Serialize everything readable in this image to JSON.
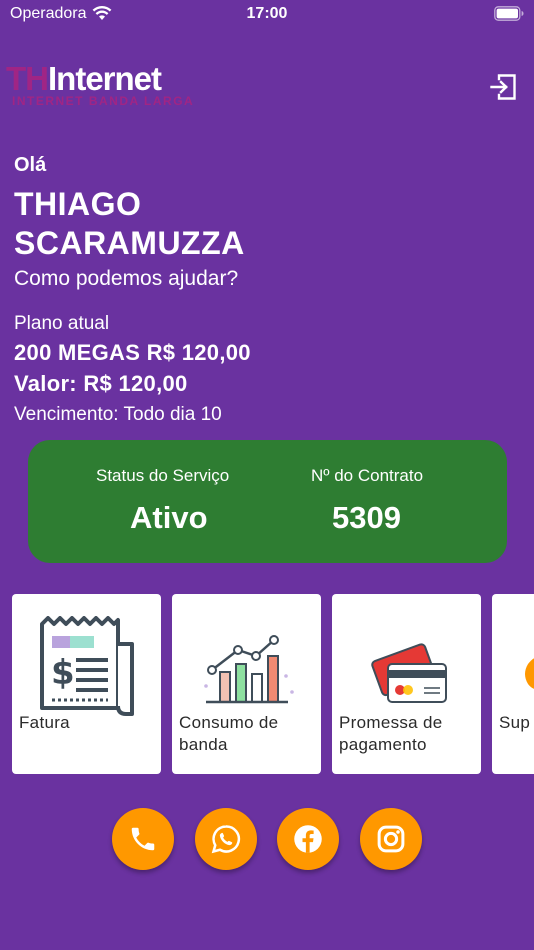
{
  "status_bar": {
    "carrier": "Operadora",
    "time": "17:00"
  },
  "header": {
    "logo_prefix": "TH",
    "logo_main": "Internet",
    "logo_tagline": "INTERNET BANDA LARGA",
    "logout_icon": "logout-icon"
  },
  "greeting": {
    "hello": "Olá",
    "name": "THIAGO SCARAMUZZA",
    "question": "Como podemos ajudar?"
  },
  "plan": {
    "label": "Plano atual",
    "name": "200 MEGAS R$ 120,00",
    "value": "Valor: R$ 120,00",
    "due": "Vencimento: Todo dia 10"
  },
  "service": {
    "status_label": "Status do Serviço",
    "status_value": "Ativo",
    "contract_label": "Nº do Contrato",
    "contract_value": "5309",
    "color": "#2e7d32"
  },
  "menu": [
    {
      "label": "Fatura",
      "icon": "invoice-icon"
    },
    {
      "label": "Consumo de banda",
      "icon": "bandwidth-chart-icon"
    },
    {
      "label": "Promessa de pagamento",
      "icon": "credit-card-icon"
    },
    {
      "label": "Sup",
      "icon": "support-icon"
    }
  ],
  "social": [
    {
      "icon": "phone-icon"
    },
    {
      "icon": "whatsapp-icon"
    },
    {
      "icon": "facebook-icon"
    },
    {
      "icon": "instagram-icon"
    }
  ],
  "colors": {
    "background": "#6a32a0",
    "accent": "#ff9800",
    "logo_pink": "#a02585"
  }
}
